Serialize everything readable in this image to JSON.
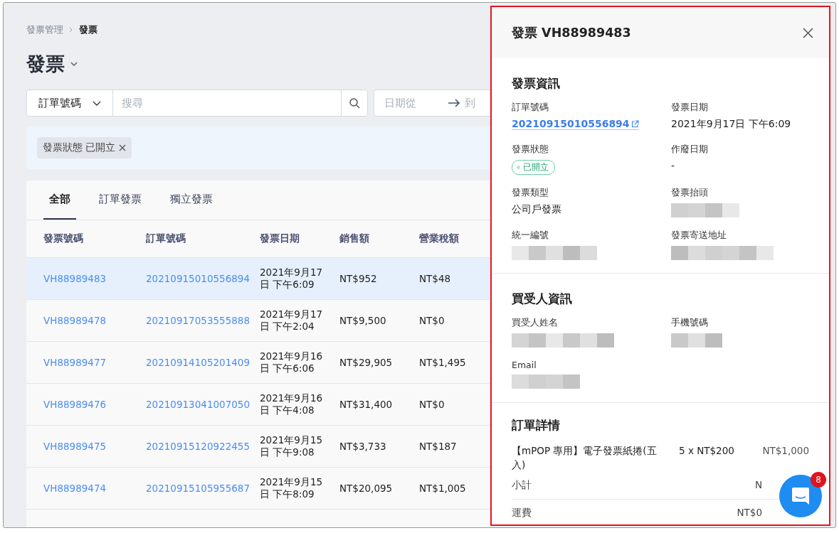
{
  "breadcrumb": [
    {
      "label": "發票管理",
      "current": false
    },
    {
      "label": "發票",
      "current": true
    }
  ],
  "page_title": "發票",
  "search": {
    "field_select": "訂單號碼",
    "placeholder": "搜尋"
  },
  "date_range": {
    "from_placeholder": "日期從",
    "to_placeholder": "到"
  },
  "filters": [
    {
      "label": "發票狀態 已開立"
    }
  ],
  "tabs": [
    {
      "label": "全部",
      "selected": true
    },
    {
      "label": "訂單發票",
      "selected": false
    },
    {
      "label": "獨立發票",
      "selected": false
    }
  ],
  "table": {
    "columns": [
      "發票號碼",
      "訂單號碼",
      "發票日期",
      "銷售額",
      "營業稅額"
    ],
    "rows": [
      {
        "invoice": "VH88989483",
        "order": "20210915010556894",
        "date": [
          "2021年9月17",
          "日 下午6:09"
        ],
        "sales": "NT$952",
        "tax": "NT$48",
        "selected": true
      },
      {
        "invoice": "VH88989478",
        "order": "20210917053555888",
        "date": [
          "2021年9月17",
          "日 下午2:04"
        ],
        "sales": "NT$9,500",
        "tax": "NT$0",
        "selected": false
      },
      {
        "invoice": "VH88989477",
        "order": "20210914105201409",
        "date": [
          "2021年9月16",
          "日 下午6:06"
        ],
        "sales": "NT$29,905",
        "tax": "NT$1,495",
        "selected": false
      },
      {
        "invoice": "VH88989476",
        "order": "20210913041007050",
        "date": [
          "2021年9月16",
          "日 下午4:08"
        ],
        "sales": "NT$31,400",
        "tax": "NT$0",
        "selected": false
      },
      {
        "invoice": "VH88989475",
        "order": "20210915120922455",
        "date": [
          "2021年9月15",
          "日 下午9:08"
        ],
        "sales": "NT$3,733",
        "tax": "NT$187",
        "selected": false
      },
      {
        "invoice": "VH88989474",
        "order": "20210915105955687",
        "date": [
          "2021年9月15",
          "日 下午8:09"
        ],
        "sales": "NT$20,095",
        "tax": "NT$1,005",
        "selected": false
      }
    ]
  },
  "drawer": {
    "title": "發票 VH88989483",
    "sections": [
      {
        "title": "發票資訊",
        "fields": [
          {
            "label": "訂單號碼",
            "kind": "link",
            "value": "20210915010556894"
          },
          {
            "label": "發票日期",
            "kind": "text",
            "value": "2021年9月17日 下午6:09"
          },
          {
            "label": "發票狀態",
            "kind": "status",
            "value": "已開立"
          },
          {
            "label": "作廢日期",
            "kind": "text",
            "value": "-"
          },
          {
            "label": "發票類型",
            "kind": "text",
            "value": "公司戶發票"
          },
          {
            "label": "發票抬頭",
            "kind": "redacted"
          },
          {
            "label": "統一編號",
            "kind": "redacted"
          },
          {
            "label": "發票寄送地址",
            "kind": "redacted"
          }
        ]
      },
      {
        "title": "買受人資訊",
        "fields": [
          {
            "label": "買受人姓名",
            "kind": "redacted"
          },
          {
            "label": "手機號碼",
            "kind": "redacted"
          },
          {
            "label": "Email",
            "kind": "redacted"
          }
        ]
      }
    ],
    "order_details": {
      "title": "訂單詳情",
      "items": [
        {
          "name": "【mPOP 專用】電子發票紙捲(五入)",
          "qty_price": "5 x NT$200",
          "total": "NT$1,000"
        }
      ],
      "summary": [
        {
          "label": "小計",
          "value": "N"
        },
        {
          "label": "運費",
          "value": "NT$0"
        }
      ]
    }
  },
  "chat": {
    "badge": "8"
  }
}
